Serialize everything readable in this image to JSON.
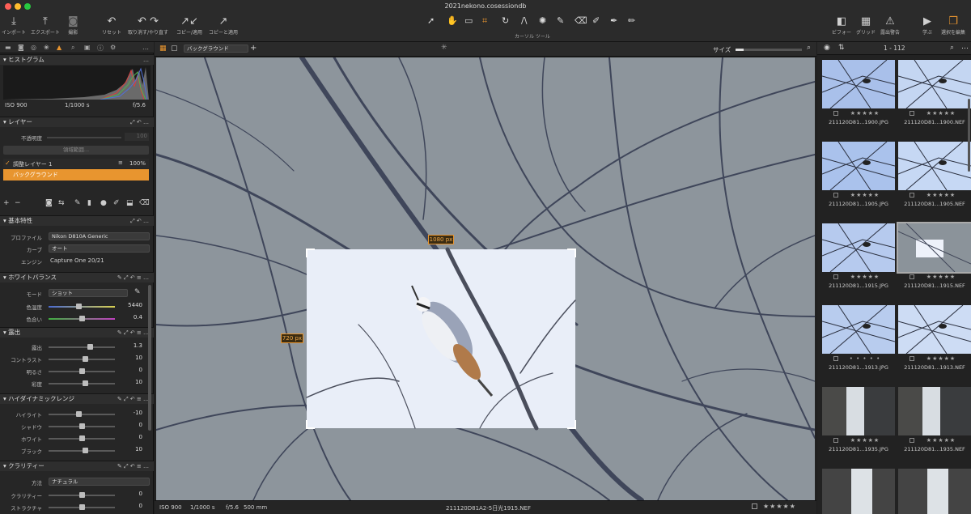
{
  "window": {
    "title": "2021nekono.cosessiondb"
  },
  "toolbar": {
    "left_buttons": [
      {
        "label": "インポート",
        "icon": "import-icon"
      },
      {
        "label": "エクスポート",
        "icon": "export-icon"
      },
      {
        "label": "撮影",
        "icon": "camera-icon"
      },
      {
        "label": "リセット",
        "icon": "reset-icon"
      },
      {
        "label": "取り消す/やり直す",
        "icon": "undo-redo-icon"
      },
      {
        "label": "コピー/適用",
        "icon": "copy-apply-icon"
      },
      {
        "label": "コピーと適用",
        "icon": "copy-and-apply-icon"
      }
    ],
    "cursor_tools_label": "カーソル ツール",
    "right_buttons": [
      {
        "label": "ビフォー",
        "icon": "before-icon"
      },
      {
        "label": "グリッド",
        "icon": "grid-icon"
      },
      {
        "label": "露出警告",
        "icon": "exposure-warning-icon"
      },
      {
        "label": "学ぶ",
        "icon": "learn-icon"
      },
      {
        "label": "選択を編集",
        "icon": "edit-selection-icon"
      }
    ]
  },
  "histogram": {
    "title": "ヒストグラム",
    "iso": "ISO 900",
    "shutter": "1/1000 s",
    "aperture": "f/5.6"
  },
  "layers": {
    "title": "レイヤー",
    "opacity_label": "不透明度",
    "opacity_value": "100",
    "refine_label": "領域範囲...",
    "adjust_layer": "調整レイヤー 1",
    "adjust_percent": "100%",
    "background_layer": "バックグラウンド"
  },
  "basic": {
    "title": "基本特性",
    "profile_label": "プロファイル",
    "profile_value": "Nikon D810A Generic",
    "curve_label": "カーブ",
    "curve_value": "オート",
    "engine_label": "エンジン",
    "engine_value": "Capture One 20/21"
  },
  "wb": {
    "title": "ホワイトバランス",
    "mode_label": "モード",
    "mode_value": "ショット",
    "sliders": [
      {
        "label": "色温度",
        "value": "5440",
        "pos": 0.45
      },
      {
        "label": "色合い",
        "value": "0.4",
        "pos": 0.5
      }
    ]
  },
  "exposure": {
    "title": "露出",
    "sliders": [
      {
        "label": "露出",
        "value": "1.3",
        "pos": 0.62
      },
      {
        "label": "コントラスト",
        "value": "10",
        "pos": 0.55
      },
      {
        "label": "明るさ",
        "value": "0",
        "pos": 0.5
      },
      {
        "label": "彩度",
        "value": "10",
        "pos": 0.55
      }
    ]
  },
  "hdr": {
    "title": "ハイダイナミックレンジ",
    "sliders": [
      {
        "label": "ハイライト",
        "value": "-10",
        "pos": 0.45
      },
      {
        "label": "シャドウ",
        "value": "0",
        "pos": 0.5
      },
      {
        "label": "ホワイト",
        "value": "0",
        "pos": 0.5
      },
      {
        "label": "ブラック",
        "value": "10",
        "pos": 0.55
      }
    ]
  },
  "clarity": {
    "title": "クラリティー",
    "method_label": "方法",
    "method_value": "ナチュラル",
    "sliders": [
      {
        "label": "クラリティー",
        "value": "0",
        "pos": 0.5
      },
      {
        "label": "ストラクチャ",
        "value": "0",
        "pos": 0.5
      }
    ]
  },
  "viewer": {
    "layer_select": "バックグラウンド",
    "size_label": "サイズ",
    "crop_width": "1080 px",
    "crop_height": "720 px",
    "status_iso": "ISO 900",
    "status_shutter": "1/1000 s",
    "status_aperture": "f/5.6",
    "status_focal": "500 mm",
    "status_filename": "211120D81A2-5日光1915.NEF"
  },
  "browser": {
    "count": "1 - 112",
    "thumbs": [
      {
        "name": "211120D81...1900.JPG",
        "stars": "★★★★★"
      },
      {
        "name": "211120D81...1900.NEF",
        "stars": "★★★★★"
      },
      {
        "name": "211120D81...1905.JPG",
        "stars": "★★★★★"
      },
      {
        "name": "211120D81...1905.NEF",
        "stars": "★★★★★"
      },
      {
        "name": "211120D81...1915.JPG",
        "stars": "★★★★★"
      },
      {
        "name": "211120D81...1915.NEF",
        "stars": "★★★★★"
      },
      {
        "name": "211120D81...1913.JPG",
        "stars": "• • • • •"
      },
      {
        "name": "211120D81...1913.NEF",
        "stars": "★★★★★"
      },
      {
        "name": "211120D81...1935.JPG",
        "stars": "★★★★★"
      },
      {
        "name": "211120D81...1935.NEF",
        "stars": "★★★★★"
      }
    ]
  },
  "colors": {
    "accent": "#e8952f",
    "panel": "#262626",
    "photo_bg": "#8a939b"
  }
}
